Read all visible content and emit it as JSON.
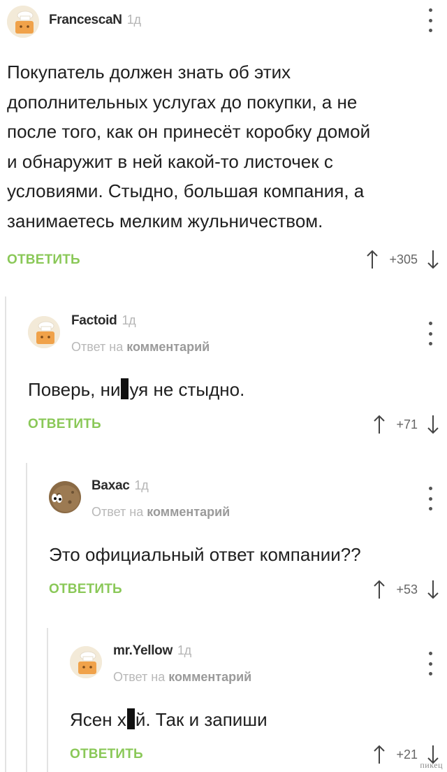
{
  "colors": {
    "reply_accent": "#8ac858",
    "thread_line": "#e3e3e3",
    "muted": "#b5b5b5"
  },
  "comments": [
    {
      "author": "FrancescaN",
      "time": "1д",
      "avatar_icon": "default-cook-avatar-icon",
      "reply_info": null,
      "text_lines": [
        "Покупатель должен знать об этих",
        "дополнительных услугах до покупки, а не",
        "после того, как он принесёт коробку домой",
        "и обнаружит в ней какой-то листочек с",
        "условиями. Стыдно, большая компания, а",
        "занимаетесь мелким жульничеством."
      ],
      "reply_label": "ОТВЕТИТЬ",
      "score": "+305"
    },
    {
      "author": "Factoid",
      "time": "1д",
      "avatar_icon": "default-cook-avatar-icon",
      "reply_info": {
        "prefix": "Ответ на",
        "link": "комментарий"
      },
      "text_parts": [
        "Поверь, ни",
        "уя не стыдно."
      ],
      "reply_label": "ОТВЕТИТЬ",
      "score": "+71"
    },
    {
      "author": "Вахас",
      "time": "1д",
      "avatar_icon": "potato-face-avatar-icon",
      "reply_info": {
        "prefix": "Ответ на",
        "link": "комментарий"
      },
      "text": "Это официальный ответ компании??",
      "reply_label": "ОТВЕТИТЬ",
      "score": "+53"
    },
    {
      "author": "mr.Yellow",
      "time": "1д",
      "avatar_icon": "default-cook-avatar-icon",
      "reply_info": {
        "prefix": "Ответ на",
        "link": "комментарий"
      },
      "text_parts": [
        "Ясен х",
        "й. Так и запиши"
      ],
      "reply_label": "ОТВЕТИТЬ",
      "score": "+21"
    }
  ],
  "watermark": "пикец"
}
